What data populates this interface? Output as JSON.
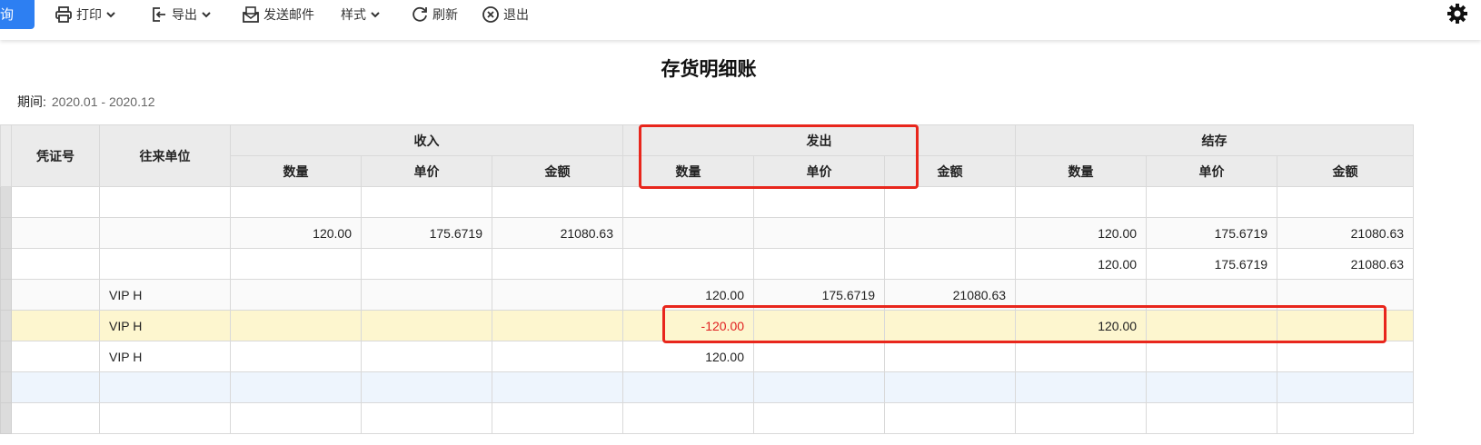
{
  "toolbar": {
    "query_label": "询",
    "print_label": "打印",
    "export_label": "导出",
    "email_label": "发送邮件",
    "style_label": "样式",
    "refresh_label": "刷新",
    "exit_label": "退出"
  },
  "report": {
    "title": "存货明细账",
    "period_label": "期间:",
    "period_value": "2020.01 - 2020.12"
  },
  "table": {
    "headers": {
      "voucher_no": "凭证号",
      "partner": "往来单位",
      "income": "收入",
      "issue": "发出",
      "balance": "结存",
      "qty": "数量",
      "price": "单价",
      "amount": "金额"
    },
    "rows": [
      {
        "style": "white",
        "partner": "",
        "in_qty": "",
        "in_price": "",
        "in_amount": "",
        "out_qty": "",
        "out_price": "",
        "out_amount": "",
        "bal_qty": "",
        "bal_price": "",
        "bal_amount": ""
      },
      {
        "style": "gray",
        "partner": "",
        "in_qty": "120.00",
        "in_price": "175.6719",
        "in_amount": "21080.63",
        "out_qty": "",
        "out_price": "",
        "out_amount": "",
        "bal_qty": "120.00",
        "bal_price": "175.6719",
        "bal_amount": "21080.63"
      },
      {
        "style": "white",
        "partner": "",
        "in_qty": "",
        "in_price": "",
        "in_amount": "",
        "out_qty": "",
        "out_price": "",
        "out_amount": "",
        "bal_qty": "120.00",
        "bal_price": "175.6719",
        "bal_amount": "21080.63"
      },
      {
        "style": "gray",
        "partner": "VIP H",
        "in_qty": "",
        "in_price": "",
        "in_amount": "",
        "out_qty": "120.00",
        "out_price": "175.6719",
        "out_amount": "21080.63",
        "bal_qty": "",
        "bal_price": "",
        "bal_amount": ""
      },
      {
        "style": "yellow",
        "partner": "VIP H",
        "in_qty": "",
        "in_price": "",
        "in_amount": "",
        "out_qty": "-120.00",
        "out_price": "",
        "out_amount": "",
        "bal_qty": "120.00",
        "bal_price": "",
        "bal_amount": ""
      },
      {
        "style": "white",
        "partner": "VIP H",
        "in_qty": "",
        "in_price": "",
        "in_amount": "",
        "out_qty": "120.00",
        "out_price": "",
        "out_amount": "",
        "bal_qty": "",
        "bal_price": "",
        "bal_amount": ""
      },
      {
        "style": "blue",
        "partner": "",
        "in_qty": "",
        "in_price": "",
        "in_amount": "",
        "out_qty": "",
        "out_price": "",
        "out_amount": "",
        "bal_qty": "",
        "bal_price": "",
        "bal_amount": ""
      },
      {
        "style": "white",
        "partner": "",
        "in_qty": "",
        "in_price": "",
        "in_amount": "",
        "out_qty": "",
        "out_price": "",
        "out_amount": "",
        "bal_qty": "",
        "bal_price": "",
        "bal_amount": ""
      }
    ]
  },
  "colors": {
    "accent": "#2d7ff2",
    "highlight_box": "#e8261c",
    "negative": "#e02020",
    "selected_row": "#fdf6cf"
  }
}
